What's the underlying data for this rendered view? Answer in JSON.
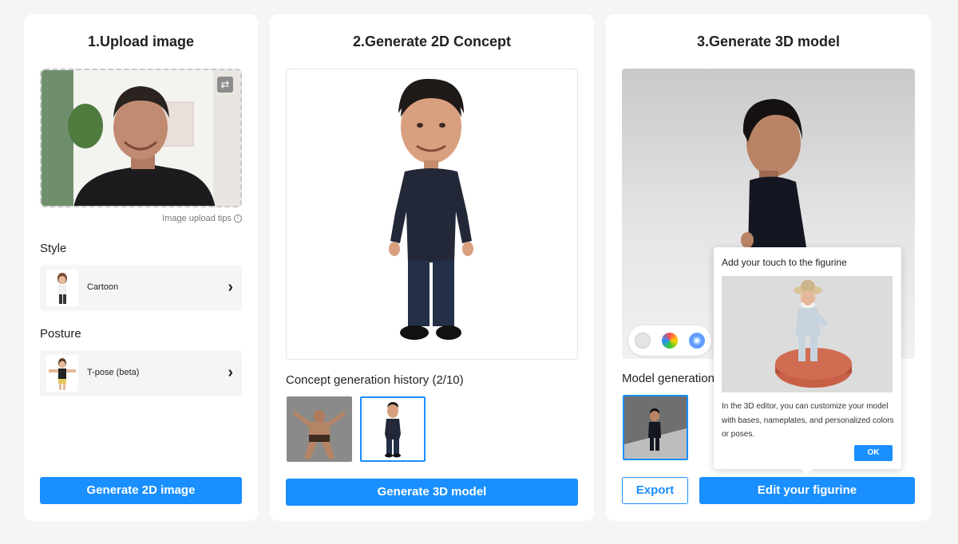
{
  "step1": {
    "title": "1.Upload image",
    "tips": "Image upload tips",
    "style_label": "Style",
    "style_value": "Cartoon",
    "posture_label": "Posture",
    "posture_value": "T-pose (beta)",
    "generate_button": "Generate 2D image"
  },
  "step2": {
    "title": "2.Generate 2D Concept",
    "history_label": "Concept generation history (2/10)",
    "generate_button": "Generate 3D model"
  },
  "step3": {
    "title": "3.Generate 3D model",
    "history_label": "Model generation",
    "export_button": "Export",
    "edit_button": "Edit your figurine",
    "swatches": [
      "#e0e0e0",
      "rainbow",
      "gradient"
    ]
  },
  "popup": {
    "title": "Add your touch to the figurine",
    "text": "In the 3D editor, you can customize your model with bases, nameplates, and personalized colors or poses.",
    "ok_button": "OK"
  },
  "colors": {
    "accent": "#1a8fff",
    "page_background": "#f5f5f5"
  }
}
